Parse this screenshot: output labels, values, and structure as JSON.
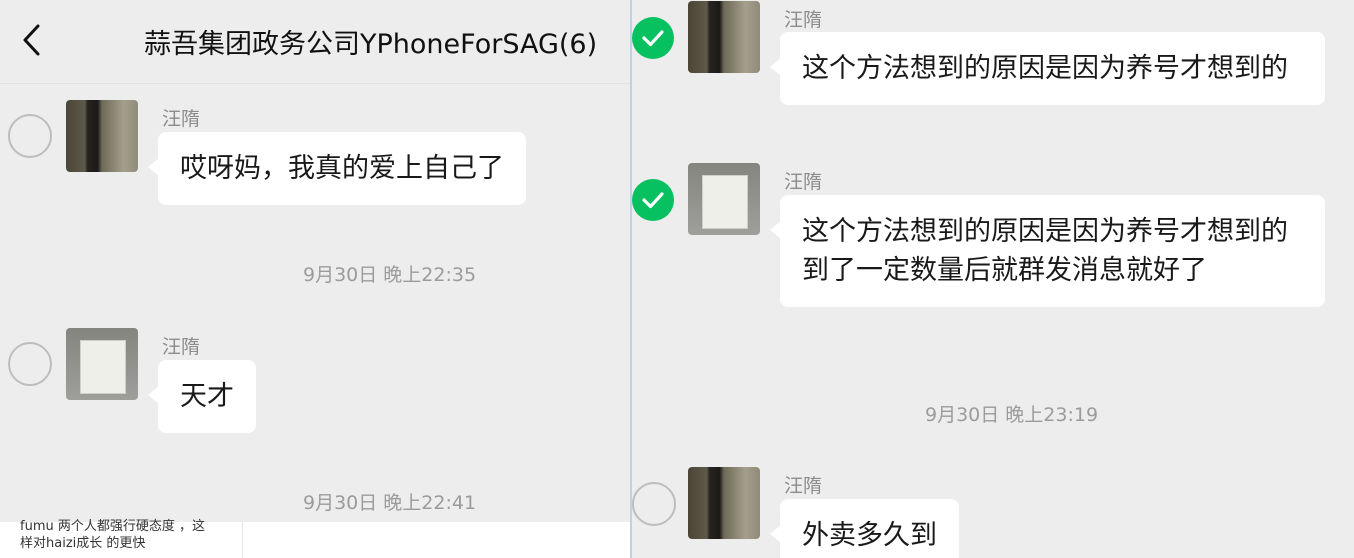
{
  "left_panel": {
    "header": {
      "title": "蒜吾集团政务公司YPhoneForSAG(6)",
      "back_icon": "chevron-left-icon"
    },
    "messages": [
      {
        "sender": "汪隋",
        "text": "哎呀妈，我真的爱上自己了",
        "selected": false
      },
      {
        "sender": "汪隋",
        "text": "天才",
        "selected": false
      }
    ],
    "timestamps": [
      "9月30日 晚上22:35",
      "9月30日 晚上22:41"
    ],
    "underlying_text": "fumu 两个人都强行硬态度 ，这\n样对haizi成长 的更快"
  },
  "right_panel": {
    "messages": [
      {
        "sender": "汪隋",
        "text": "这个方法想到的原因是因为养号才想到的",
        "selected": true
      },
      {
        "sender": "汪隋",
        "text": "这个方法想到的原因是因为养号才想到的\n到了一定数量后就群发消息就好了",
        "selected": true
      },
      {
        "sender": "汪隋",
        "text": "外卖多久到",
        "selected": false
      }
    ],
    "timestamp": "9月30日 晚上23:19"
  },
  "colors": {
    "background": "#ededed",
    "bubble": "#ffffff",
    "check_green": "#07c160",
    "divider": "#bcd0f0"
  }
}
